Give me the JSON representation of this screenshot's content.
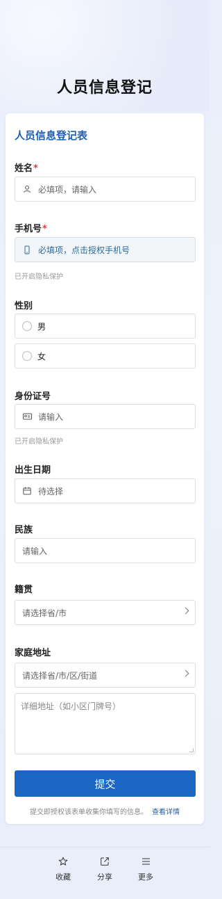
{
  "page_title": "人员信息登记",
  "form": {
    "title": "人员信息登记表",
    "name": {
      "label": "姓名",
      "required_mark": "*",
      "placeholder": "必填项，请输入"
    },
    "phone": {
      "label": "手机号",
      "required_mark": "*",
      "placeholder": "必填项，点击授权手机号",
      "hint": "已开启隐私保护"
    },
    "gender": {
      "label": "性别",
      "options": [
        "男",
        "女"
      ]
    },
    "id_number": {
      "label": "身份证号",
      "placeholder": "请输入",
      "hint": "已开启隐私保护"
    },
    "birth_date": {
      "label": "出生日期",
      "placeholder": "待选择"
    },
    "ethnicity": {
      "label": "民族",
      "placeholder": "请输入"
    },
    "native_place": {
      "label": "籍贯",
      "placeholder": "请选择省/市"
    },
    "address": {
      "label": "家庭地址",
      "region_placeholder": "请选择省/市/区/街道",
      "detail_placeholder": "详细地址（如小区门牌号）"
    },
    "submit_label": "提交",
    "notice_text": "提交即授权该表单收集你填写的信息。",
    "notice_link": "查看详情"
  },
  "bottom_nav": {
    "items": [
      {
        "label": "收藏",
        "icon": "star-icon"
      },
      {
        "label": "分享",
        "icon": "share-icon"
      },
      {
        "label": "更多",
        "icon": "menu-icon"
      }
    ]
  },
  "colors": {
    "accent": "#1a66c2",
    "title_blue": "#1f5fb3",
    "required": "#e23a3a"
  }
}
